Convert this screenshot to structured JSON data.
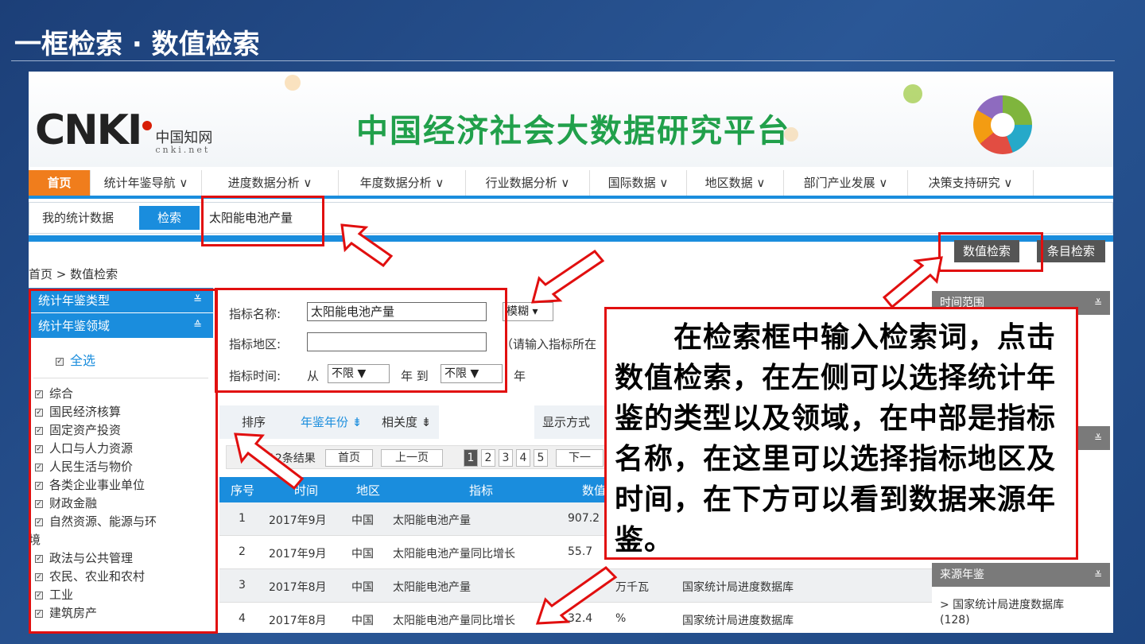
{
  "slide": {
    "title": "一框检索 · 数值检索"
  },
  "site": {
    "logo_mark": "CNKI",
    "logo_cn": "中国知网",
    "logo_domain": "cnki.net",
    "platform_title": "中国经济社会大数据研究平台"
  },
  "nav": [
    "首页",
    "统计年鉴导航 ∨",
    "进度数据分析 ∨",
    "年度数据分析 ∨",
    "行业数据分析 ∨",
    "国际数据 ∨",
    "地区数据 ∨",
    "部门产业发展 ∨",
    "决策支持研究 ∨"
  ],
  "subnav": {
    "mine": "我的统计数据",
    "search": "检索",
    "query": "太阳能电池产量"
  },
  "buttons": {
    "numeric": "数值检索",
    "entry": "条目检索"
  },
  "breadcrumb": "首页 > 数值检索",
  "left_panel": {
    "type_title": "统计年鉴类型",
    "domain_title": "统计年鉴领域",
    "select_all": "全选",
    "items": [
      "综合",
      "国民经济核算",
      "固定资产投资",
      "人口与人力资源",
      "人民生活与物价",
      "各类企业事业单位",
      "财政金融",
      "自然资源、能源与环",
      "境",
      "政法与公共管理",
      "农民、农业和农村",
      "工业",
      "建筑房产"
    ]
  },
  "filter": {
    "name_label": "指标名称:",
    "name_value": "太阳能电池产量",
    "mode": "模糊 ▾",
    "region_label": "指标地区:",
    "region_hint": "（请输入指标所在",
    "time_label": "指标时间:",
    "from": "从",
    "from_value": "不限  ▼",
    "year_to": "年  到",
    "to_value": "不限  ▼",
    "year": "年"
  },
  "toolbar": {
    "sort": "排序",
    "year_sort": "年鉴年份 ⇟",
    "relevance": "相关度 ⇟",
    "display": "显示方式"
  },
  "pager": {
    "results": "12条结果",
    "first": "首页",
    "prev": "上一页",
    "pages": [
      "1",
      "2",
      "3",
      "4",
      "5"
    ],
    "next": "下一"
  },
  "table": {
    "headers": [
      "序号",
      "时间",
      "地区",
      "指标",
      "数值"
    ],
    "rows": [
      [
        "1",
        "2017年9月",
        "中国",
        "太阳能电池产量",
        "907.2",
        "",
        ""
      ],
      [
        "2",
        "2017年9月",
        "中国",
        "太阳能电池产量同比增长",
        "55.7",
        "",
        ""
      ],
      [
        "3",
        "2017年8月",
        "中国",
        "太阳能电池产量",
        "",
        "万千瓦",
        "国家统计局进度数据库"
      ],
      [
        "4",
        "2017年8月",
        "中国",
        "太阳能电池产量同比增长",
        "32.4",
        "%",
        "国家统计局进度数据库"
      ]
    ]
  },
  "right_panel": {
    "time_range": "时间范围",
    "source": "来源年鉴",
    "source_item": "> 国家统计局进度数据库",
    "source_count": "(128)"
  },
  "callout": "　　在检索框中输入检索词，点击数值检索，在左侧可以选择统计年鉴的类型以及领域，在中部是指标名称，在这里可以选择指标地区及时间，在下方可以看到数据来源年鉴。",
  "colors": {
    "accent_blue": "#1a8ddd",
    "accent_orange": "#f07d1c",
    "annotation_red": "#e10f0f",
    "brand_green": "#21a04b"
  }
}
